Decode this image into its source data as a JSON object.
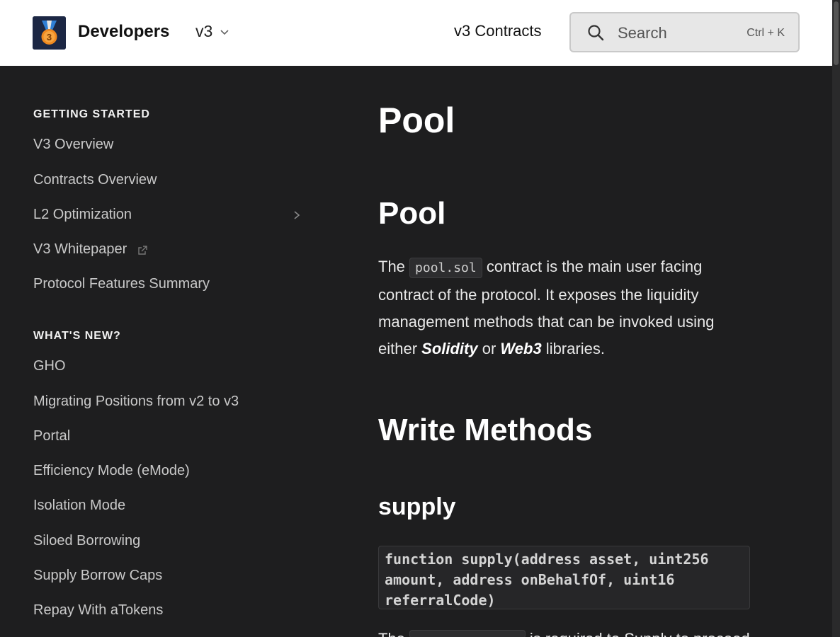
{
  "header": {
    "brand": "Developers",
    "version": "v3",
    "nav_link": "v3 Contracts",
    "search_placeholder": "Search",
    "search_shortcut": "Ctrl + K"
  },
  "sidebar": {
    "sections": [
      {
        "title": "GETTING STARTED",
        "items": [
          {
            "label": "V3 Overview"
          },
          {
            "label": "Contracts Overview"
          },
          {
            "label": "L2 Optimization"
          },
          {
            "label": "V3 Whitepaper"
          },
          {
            "label": "Protocol Features Summary"
          }
        ]
      },
      {
        "title": "WHAT'S NEW?",
        "items": [
          {
            "label": "GHO"
          },
          {
            "label": "Migrating Positions from v2 to v3"
          },
          {
            "label": "Portal"
          },
          {
            "label": "Efficiency Mode (eMode)"
          },
          {
            "label": "Isolation Mode"
          },
          {
            "label": "Siloed Borrowing"
          },
          {
            "label": "Supply Borrow Caps"
          },
          {
            "label": "Repay With aTokens"
          }
        ]
      }
    ]
  },
  "main": {
    "page_title": "Pool",
    "section_heading": "Pool",
    "intro": {
      "text_before": "The ",
      "code": "pool.sol",
      "text_middle": " contract is the main user facing contract of the protocol. It exposes the liquidity management methods that can be invoked using either ",
      "emph1": "Solidity",
      "text_or": " or ",
      "emph2": "Web3",
      "text_after": " libraries."
    },
    "write_methods_heading": "Write Methods",
    "method_heading": "supply",
    "code_signature": "function supply(address asset, uint256\namount, address onBehalfOf, uint16\nreferralCode)",
    "partial_text_before": "The",
    "partial_text_after": "is required to Supply to proceed"
  }
}
